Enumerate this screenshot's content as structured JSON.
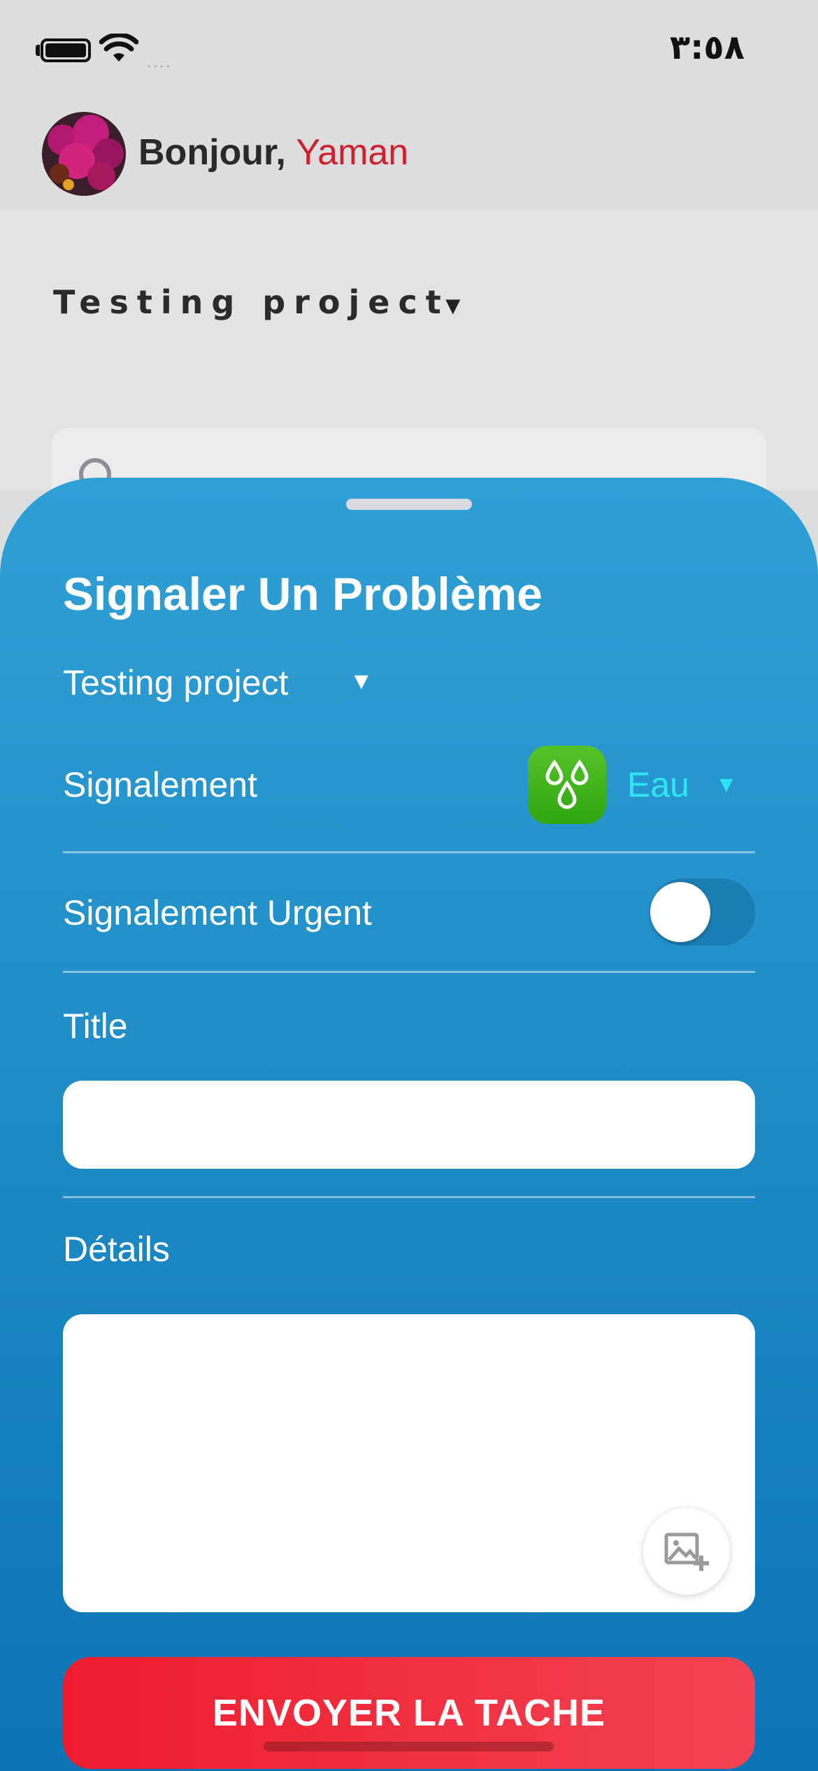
{
  "status_bar": {
    "time": "٣:٥٨",
    "signal": "...."
  },
  "header": {
    "greeting": "Bonjour,",
    "user_name": "Yaman"
  },
  "background": {
    "project_name": "Testing project",
    "caret": "▼"
  },
  "sheet": {
    "title": "Signaler Un Problème",
    "project": "Testing project",
    "caret": "▼",
    "report_label": "Signalement",
    "category_value": "Eau",
    "category_icon": "water-drops-icon",
    "urgent_label": "Signalement Urgent",
    "urgent_enabled": false,
    "title_label": "Title",
    "title_value": "",
    "details_label": "Détails",
    "details_value": "",
    "attach_icon": "add-image-icon",
    "submit_label": "ENVOYER LA TACHE"
  },
  "colors": {
    "accent_red": "#d0202d",
    "sheet_top": "#2fa0d6",
    "sheet_bottom": "#0b74b6",
    "category_green": "#3fb31a",
    "category_text": "#2ee6f2",
    "submit_red": "#ee1c2e"
  }
}
